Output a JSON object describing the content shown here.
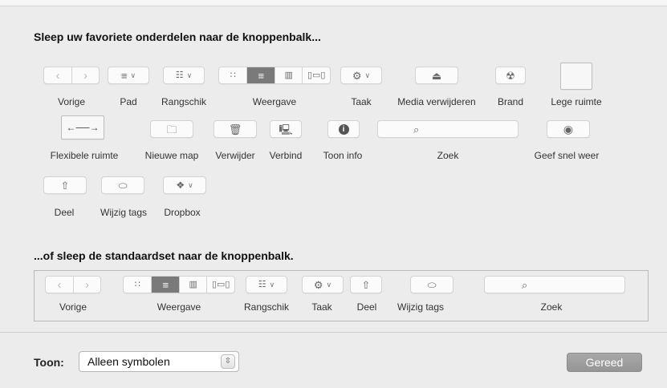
{
  "headings": {
    "favorites": "Sleep uw favoriete onderdelen naar de knoppenbalk...",
    "default_set": "...of sleep de standaardset naar de knoppenbalk."
  },
  "items": {
    "back": "Vorige",
    "path": "Pad",
    "arrange": "Rangschik",
    "view": "Weergave",
    "action": "Taak",
    "eject": "Media verwijderen",
    "burn": "Brand",
    "space": "Lege ruimte",
    "flexible_space": "Flexibele ruimte",
    "new_folder": "Nieuwe map",
    "delete": "Verwijder",
    "connect": "Verbind",
    "get_info": "Toon info",
    "search": "Zoek",
    "quick_look": "Geef snel weer",
    "share": "Deel",
    "edit_tags": "Wijzig tags",
    "dropbox": "Dropbox"
  },
  "default_set": {
    "back": "Vorige",
    "view": "Weergave",
    "arrange": "Rangschik",
    "action": "Taak",
    "share": "Deel",
    "edit_tags": "Wijzig tags",
    "search": "Zoek"
  },
  "footer": {
    "show_label": "Toon:",
    "show_value": "Alleen symbolen",
    "done_label": "Gereed"
  },
  "icons": {
    "back": "chevron-left-icon",
    "forward": "chevron-right-icon",
    "path": "path-list-icon",
    "arrange": "arrange-grid-icon",
    "view_icons": "icon-view-icon",
    "view_list": "list-view-icon",
    "view_columns": "column-view-icon",
    "view_coverflow": "coverflow-view-icon",
    "action": "gear-icon",
    "eject": "eject-icon",
    "burn": "burn-radiation-icon",
    "flexible_space": "double-arrow-icon",
    "new_folder": "new-folder-icon",
    "delete": "trash-icon",
    "connect": "connect-server-icon",
    "get_info": "info-icon",
    "search": "magnifier-icon",
    "quick_look": "eye-icon",
    "share": "share-icon",
    "edit_tags": "tag-icon",
    "dropbox": "dropbox-icon"
  },
  "colors": {
    "background": "#ececec",
    "button_face": "#fbfbfb",
    "selected_segment": "#7a7a7a",
    "done_button": "#9e9e9e"
  }
}
